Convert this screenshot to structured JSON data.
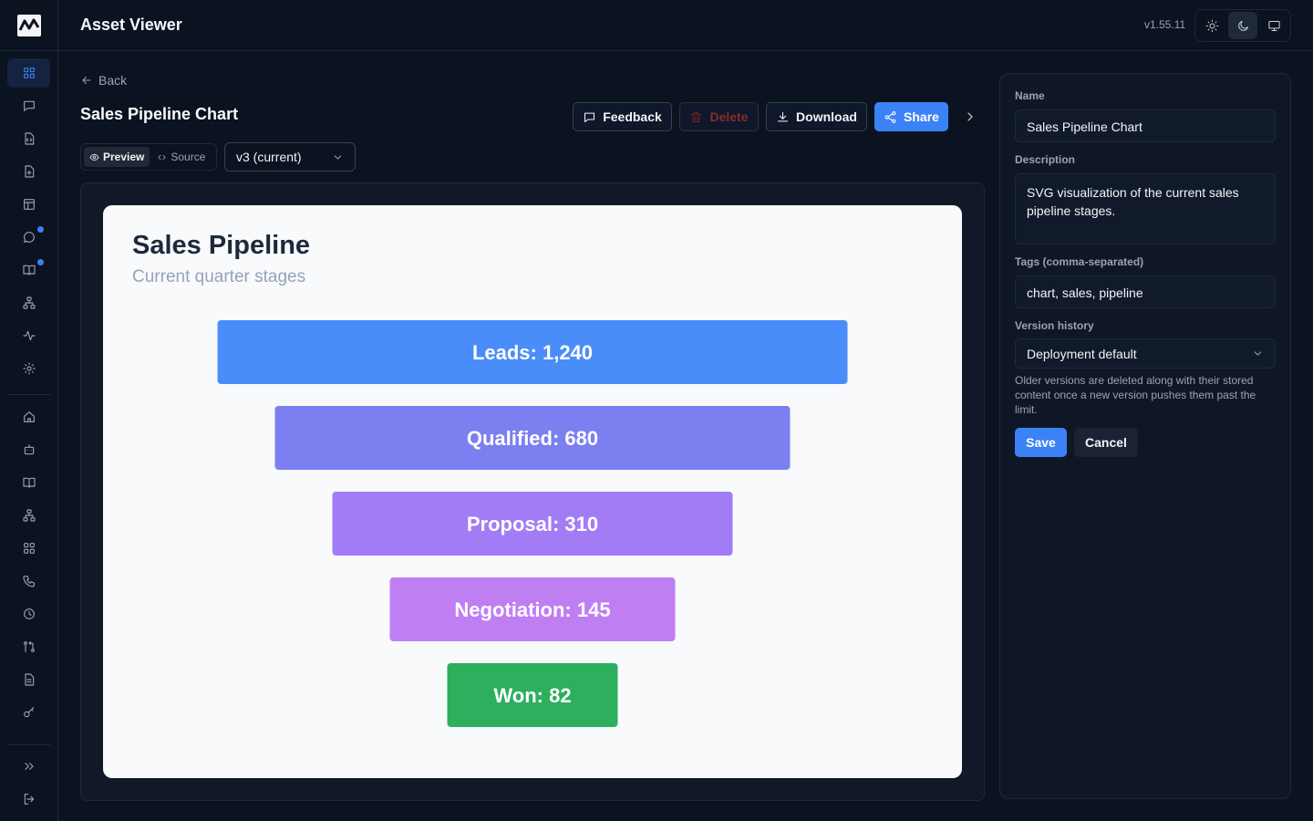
{
  "app": {
    "title": "Asset Viewer",
    "version": "v1.55.11"
  },
  "header": {
    "back_label": "Back",
    "asset_title": "Sales Pipeline Chart"
  },
  "actions": {
    "feedback": "Feedback",
    "delete": "Delete",
    "download": "Download",
    "share": "Share"
  },
  "view_toggle": {
    "preview": "Preview",
    "source": "Source",
    "selected": "Preview"
  },
  "version_select": {
    "value": "v3 (current)"
  },
  "chart_data": {
    "type": "funnel",
    "title": "Sales Pipeline",
    "subtitle": "Current quarter stages",
    "stages": [
      {
        "label": "Leads: 1,240",
        "name": "Leads",
        "value": 1240,
        "color": "#4b8df8"
      },
      {
        "label": "Qualified: 680",
        "name": "Qualified",
        "value": 680,
        "color": "#7c7ff0"
      },
      {
        "label": "Proposal: 310",
        "name": "Proposal",
        "value": 310,
        "color": "#a27cf5"
      },
      {
        "label": "Negotiation: 145",
        "name": "Negotiation",
        "value": 145,
        "color": "#c07ef3"
      },
      {
        "label": "Won: 82",
        "name": "Won",
        "value": 82,
        "color": "#2daf5d"
      }
    ]
  },
  "form": {
    "name_label": "Name",
    "name_value": "Sales Pipeline Chart",
    "description_label": "Description",
    "description_value": "SVG visualization of the current sales pipeline stages.",
    "tags_label": "Tags (comma-separated)",
    "tags_value": "chart, sales, pipeline",
    "history_label": "Version history",
    "history_value": "Deployment default",
    "history_hint": "Older versions are deleted along with their stored content once a new version pushes them past the limit.",
    "save": "Save",
    "cancel": "Cancel"
  },
  "colors": {
    "accent": "#3b82f6",
    "background": "#0b1220",
    "badge": "#3b82f6"
  }
}
